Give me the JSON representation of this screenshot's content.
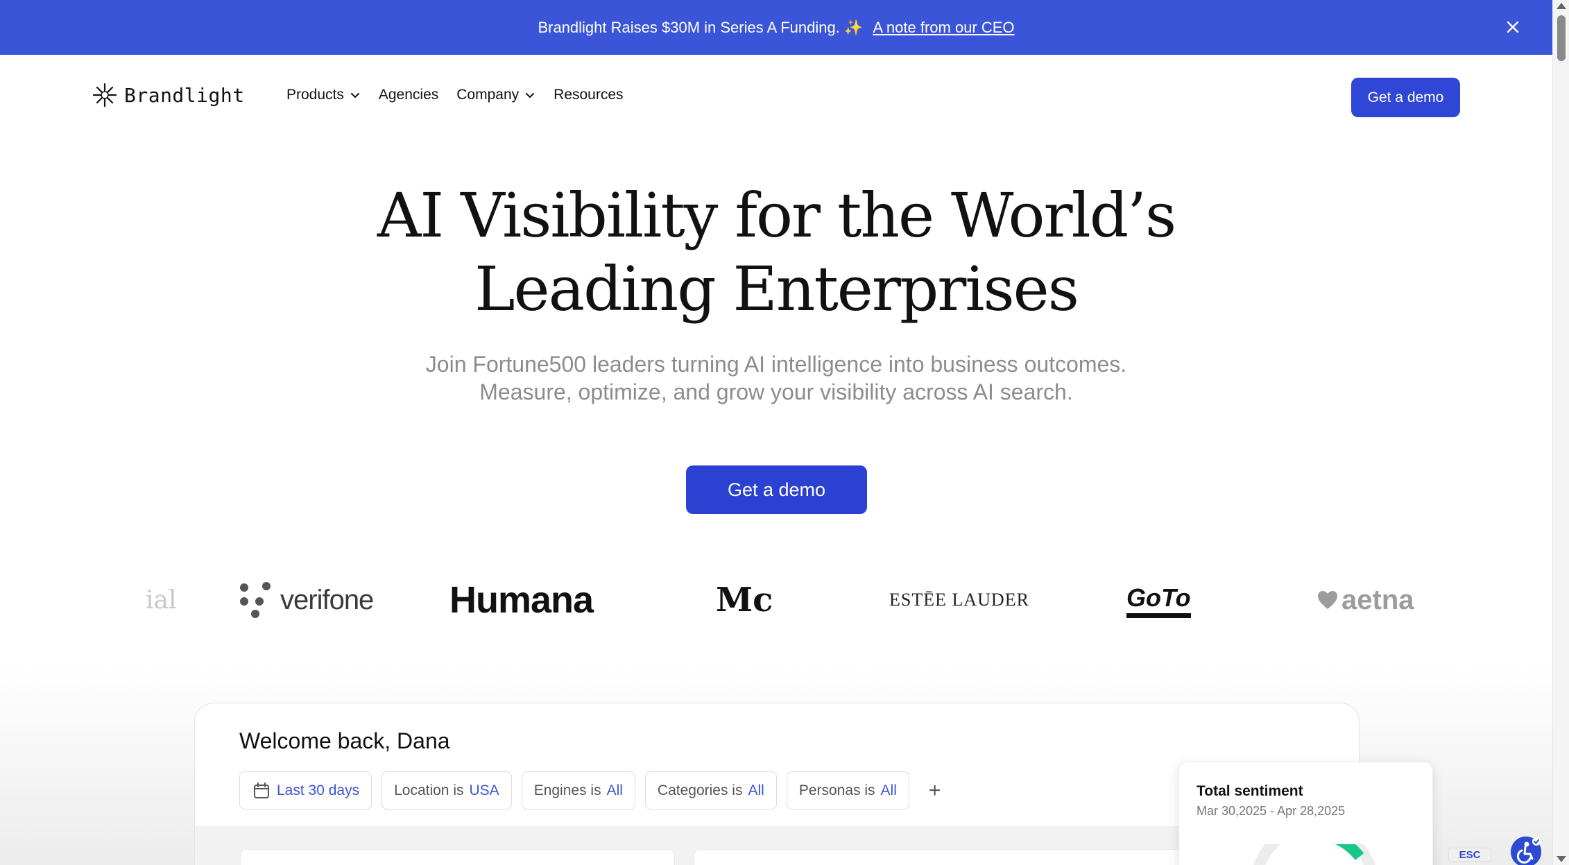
{
  "banner": {
    "text": "Brandlight Raises $30M in Series A Funding. ✨",
    "link": "A note from our CEO"
  },
  "nav": {
    "brand": "Brandlight",
    "items": [
      {
        "label": "Products",
        "has_dropdown": true
      },
      {
        "label": "Agencies",
        "has_dropdown": false
      },
      {
        "label": "Company",
        "has_dropdown": true
      },
      {
        "label": "Resources",
        "has_dropdown": false
      }
    ],
    "cta": "Get a demo"
  },
  "hero": {
    "title_line1": "AI Visibility for the World’s",
    "title_line2": "Leading Enterprises",
    "subtitle_line1": "Join Fortune500 leaders turning AI intelligence into business outcomes.",
    "subtitle_line2": "Measure, optimize, and grow your visibility across AI search.",
    "cta": "Get a demo"
  },
  "logos": {
    "partial_left": "ial",
    "verifone": "verifone",
    "humana": "Humana",
    "mc": "Mc",
    "estee": "ESTĒE LAUDER",
    "goto": "GoTo",
    "aetna": "aetna"
  },
  "dashboard": {
    "welcome": "Welcome back, Dana",
    "filters": [
      {
        "label": "",
        "value": "Last 30 days",
        "icon": "calendar-icon"
      },
      {
        "label": "Location is",
        "value": "USA"
      },
      {
        "label": "Engines is",
        "value": "All"
      },
      {
        "label": "Categories is",
        "value": "All"
      },
      {
        "label": "Personas is",
        "value": "All"
      }
    ],
    "add_filter": "+",
    "sentiment": {
      "title": "Total sentiment",
      "date_range": "Mar 30,2025 - Apr 28,2025"
    }
  },
  "widgets": {
    "esc": "ESC"
  },
  "colors": {
    "banner": "#3b55d9",
    "primary": "#2f46d6",
    "accent_value": "#3a55d6",
    "gauge_green": "#19c98a"
  }
}
